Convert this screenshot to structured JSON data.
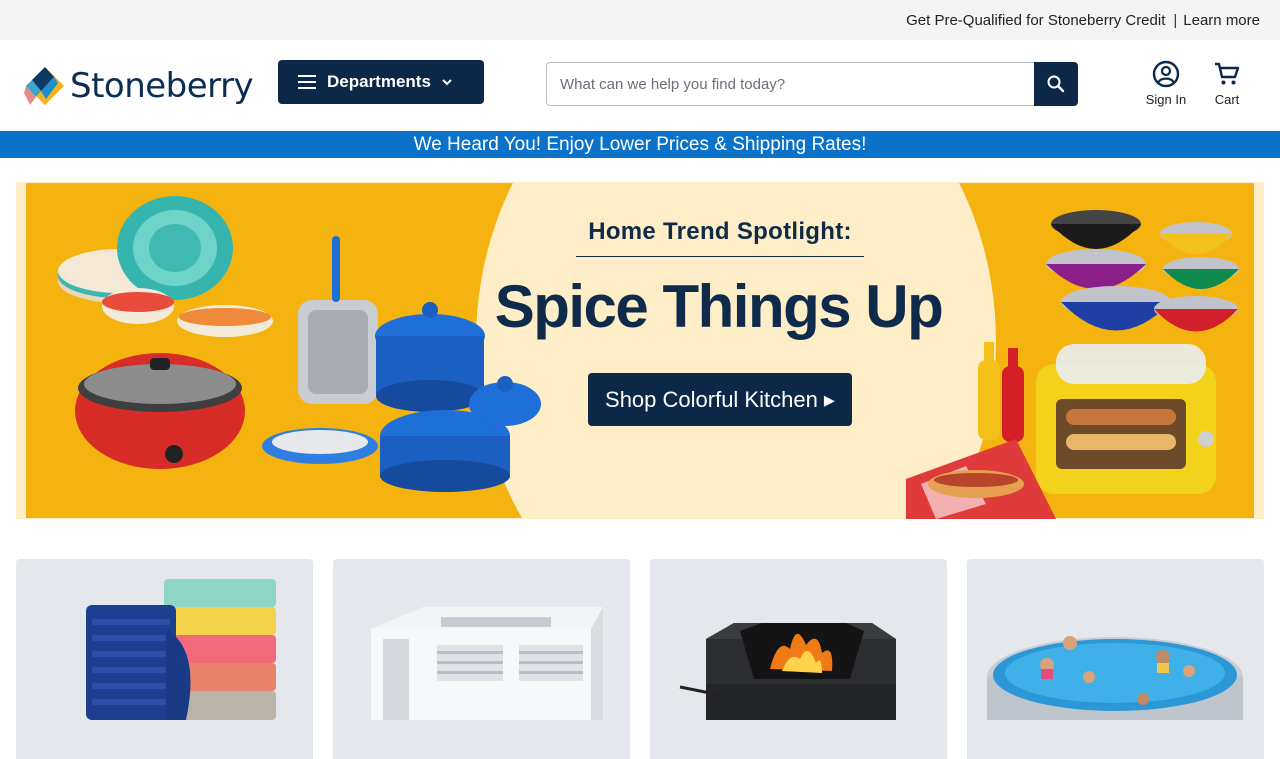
{
  "topbar": {
    "credit_text": "Get Pre-Qualified for Stoneberry Credit",
    "separator": "|",
    "learn_more": "Learn more"
  },
  "header": {
    "logo_text": "Stoneberry",
    "departments_label": "Departments",
    "search_placeholder": "What can we help you find today?",
    "search_value": "",
    "signin_label": "Sign In",
    "cart_label": "Cart"
  },
  "promo": {
    "text": "We Heard You! Enjoy Lower Prices & Shipping Rates!"
  },
  "hero": {
    "kicker": "Home Trend Spotlight:",
    "title": "Spice Things Up",
    "cta": "Shop Colorful Kitchen ▸"
  },
  "categories": [
    {
      "name": "towels"
    },
    {
      "name": "air-conditioner"
    },
    {
      "name": "fire-pit"
    },
    {
      "name": "pool"
    }
  ],
  "colors": {
    "brand_navy": "#0c2848",
    "promo_blue": "#0a72c9",
    "hero_yellow": "#f5b30f",
    "hero_cream": "#fdeec7"
  }
}
